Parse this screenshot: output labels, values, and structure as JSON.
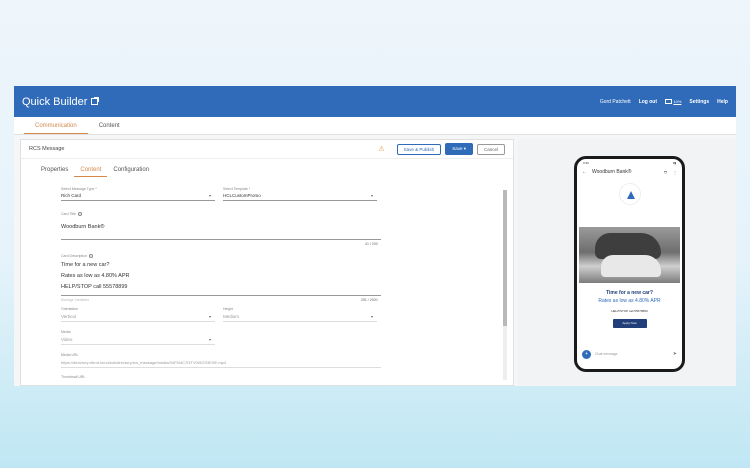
{
  "header": {
    "brand": "Quick Builder",
    "user": "Gord Patchett",
    "logout": "Log out",
    "messages_count": "10%",
    "settings": "Settings",
    "help": "Help"
  },
  "main_tabs": [
    {
      "label": "Communication",
      "active": true
    },
    {
      "label": "Content",
      "active": false
    }
  ],
  "panel": {
    "title": "RCS Message",
    "save_publish": "Save & Publish",
    "save": "Save",
    "cancel": "Cancel"
  },
  "inner_tabs": [
    {
      "label": "Properties",
      "active": false
    },
    {
      "label": "Content",
      "active": true
    },
    {
      "label": "Configuration",
      "active": false
    }
  ],
  "form": {
    "message_type_label": "Select Message Type *",
    "message_type_value": "Rich Card",
    "template_label": "Select Template *",
    "template_value": "HCLCustomPromo",
    "card_title_label": "Card Title",
    "card_title_value": "Woodburn Bank®",
    "card_title_counter": "41 / 200",
    "card_desc_label": "Card Description",
    "card_desc_lines": [
      "Time for a new car?",
      "Rates as low as 4.80% APR",
      "HELP/STOP call 55578899"
    ],
    "manage_link": "Manage Variables",
    "card_desc_counter": "251 / 2000",
    "orientation_label": "Orientation",
    "orientation_value": "Vertical",
    "height_label": "Height",
    "height_value": "Medium",
    "media_label": "Media",
    "media_value": "Video",
    "media_url_label": "Media URL",
    "media_url_value": "https://directory.vibrnt.io/rcsbot/directory/rcs_message/media/04F5I4C7I3TV0I9GS3ESE.mp4",
    "thumbnail_label": "Thumbnail URL"
  },
  "phone": {
    "time": "9:30",
    "bank_name": "Woodburn Bank®",
    "card_title": "Time for a new car?",
    "card_sub": "Rates as low as 4.80% APR",
    "card_help": "HELP/STOP call 55578899",
    "apply_button": "Apply Now",
    "chat_placeholder": "Chat message"
  },
  "colors": {
    "topbar": "#2f6bb8",
    "accent_tab": "#d4884a",
    "primary": "#2f6bb8",
    "warning": "#e39b35"
  }
}
